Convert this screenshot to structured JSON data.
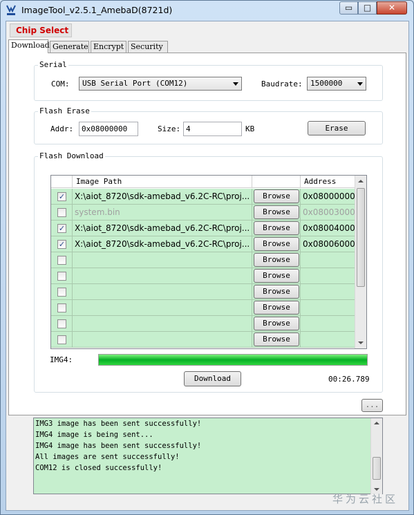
{
  "window": {
    "title": "ImageTool_v2.5.1_AmebaD(8721d)",
    "controls": {
      "minimize": "▭",
      "maximize": "□",
      "close": "✕"
    }
  },
  "chip_select": {
    "label": "Chip Select"
  },
  "tabs": [
    {
      "label": "Download",
      "active": true
    },
    {
      "label": "Generate"
    },
    {
      "label": "Encrypt"
    },
    {
      "label": "Security"
    }
  ],
  "serial": {
    "group_title": "Serial",
    "com_label": "COM:",
    "com_value": "USB Serial Port (COM12)",
    "baud_label": "Baudrate:",
    "baud_value": "1500000"
  },
  "flash_erase": {
    "group_title": "Flash Erase",
    "addr_label": "Addr:",
    "addr_value": "0x08000000",
    "size_label": "Size:",
    "size_value": "4",
    "size_unit": "KB",
    "erase_button": "Erase"
  },
  "flash_download": {
    "group_title": "Flash Download",
    "columns": {
      "path": "Image Path",
      "address": "Address"
    },
    "browse_label": "Browse",
    "rows": [
      {
        "checked": true,
        "enabled": true,
        "path": "X:\\aiot_8720\\sdk-amebad_v6.2C-RC\\proj...",
        "address": "0x08000000"
      },
      {
        "checked": false,
        "enabled": false,
        "path": "system.bin",
        "address": "0x08003000"
      },
      {
        "checked": true,
        "enabled": true,
        "path": "X:\\aiot_8720\\sdk-amebad_v6.2C-RC\\proj...",
        "address": "0x08004000"
      },
      {
        "checked": true,
        "enabled": true,
        "path": "X:\\aiot_8720\\sdk-amebad_v6.2C-RC\\proj...",
        "address": "0x08006000"
      },
      {
        "checked": false,
        "enabled": true,
        "path": "",
        "address": ""
      },
      {
        "checked": false,
        "enabled": true,
        "path": "",
        "address": ""
      },
      {
        "checked": false,
        "enabled": true,
        "path": "",
        "address": ""
      },
      {
        "checked": false,
        "enabled": true,
        "path": "",
        "address": ""
      },
      {
        "checked": false,
        "enabled": true,
        "path": "",
        "address": ""
      },
      {
        "checked": false,
        "enabled": true,
        "path": "",
        "address": ""
      }
    ],
    "progress_label": "IMG4:",
    "progress_percent": 100,
    "download_button": "Download",
    "elapsed": "00:26.789"
  },
  "more_button": "...",
  "log": [
    "IMG3 image has been sent successfully!",
    "IMG4 image is being sent...",
    "IMG4 image has been sent successfully!",
    "All images are sent successfully!",
    "COM12 is closed successfully!"
  ],
  "watermark": "华为云社区",
  "colors": {
    "row_bg": "#c6efce",
    "progress": "#06b025",
    "chip_select": "#d00000"
  }
}
